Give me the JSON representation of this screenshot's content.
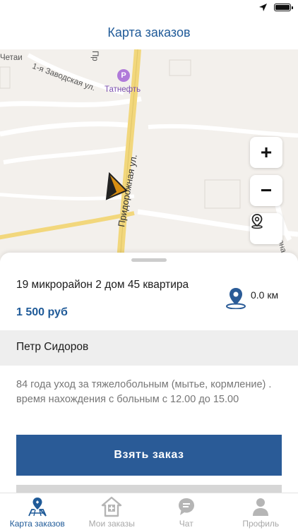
{
  "nav": {
    "title": "Карта заказов"
  },
  "map": {
    "labels": {
      "chetai": "Четаи",
      "zavodskaya": "1-я Заводская ул.",
      "pr": "Пр",
      "tatneft": "Татнефть",
      "pridorozhnaya": "Придорожная ул.",
      "hutornaya": "Хуторна"
    },
    "zoom_in": "+",
    "zoom_out": "−",
    "colors": {
      "road_major": "#f2d77c",
      "land": "#f3f0ec",
      "marker": "#b07ad9"
    }
  },
  "order": {
    "address": "19 микрорайон 2 дом 45 квартира",
    "price": "1 500 руб",
    "distance": "0.0 км",
    "client": "Петр Сидоров",
    "description": "84 года уход за тяжелобольным (мытье, кормление) . время нахождения с больным с 12.00 до 15.00",
    "take_label": "Взять заказ"
  },
  "tabs": [
    {
      "label": "Карта заказов",
      "icon": "map-marker-icon",
      "active": true
    },
    {
      "label": "Мои заказы",
      "icon": "home-plus-icon",
      "active": false
    },
    {
      "label": "Чат",
      "icon": "chat-bubble-icon",
      "active": false
    },
    {
      "label": "Профиль",
      "icon": "user-icon",
      "active": false
    }
  ],
  "colors": {
    "accent": "#1f5a98",
    "button": "#2a5b97",
    "client_row": "#eeeeee"
  }
}
